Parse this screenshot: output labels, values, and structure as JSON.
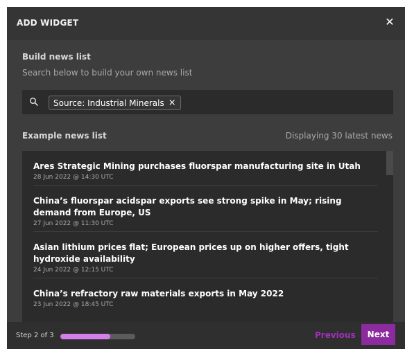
{
  "dialog": {
    "title": "ADD WIDGET",
    "close_icon": "close-icon"
  },
  "build": {
    "title": "Build news list",
    "subtitle": "Search below to build your own news list"
  },
  "search": {
    "icon": "search-icon",
    "chip_label": "Source: Industrial Minerals"
  },
  "example": {
    "title": "Example news list",
    "count_text": "Displaying 30 latest news"
  },
  "news": [
    {
      "headline": "Ares Strategic Mining purchases fluorspar manufacturing site in Utah",
      "date": "28 Jun 2022 @ 14:30 UTC"
    },
    {
      "headline": "China’s fluorspar acidspar exports see strong spike in May; rising demand from Europe, US",
      "date": "27 Jun 2022 @ 11:30 UTC"
    },
    {
      "headline": "Asian lithium prices flat; European prices up on higher offers, tight hydroxide availability",
      "date": "24 Jun 2022 @ 12:15 UTC"
    },
    {
      "headline": "China’s refractory raw materials exports in May 2022",
      "date": "23 Jun 2022 @ 18:45 UTC"
    }
  ],
  "footer": {
    "step_text": "Step 2 of 3",
    "progress_fraction": 0.667,
    "previous_label": "Previous",
    "next_label": "Next"
  },
  "colors": {
    "accent": "#8c2a9f",
    "progress": "#d47ee9",
    "previous_text": "#a02fba",
    "modal_bg": "#3d3d3d",
    "panel_bg": "#2b2b2b"
  }
}
